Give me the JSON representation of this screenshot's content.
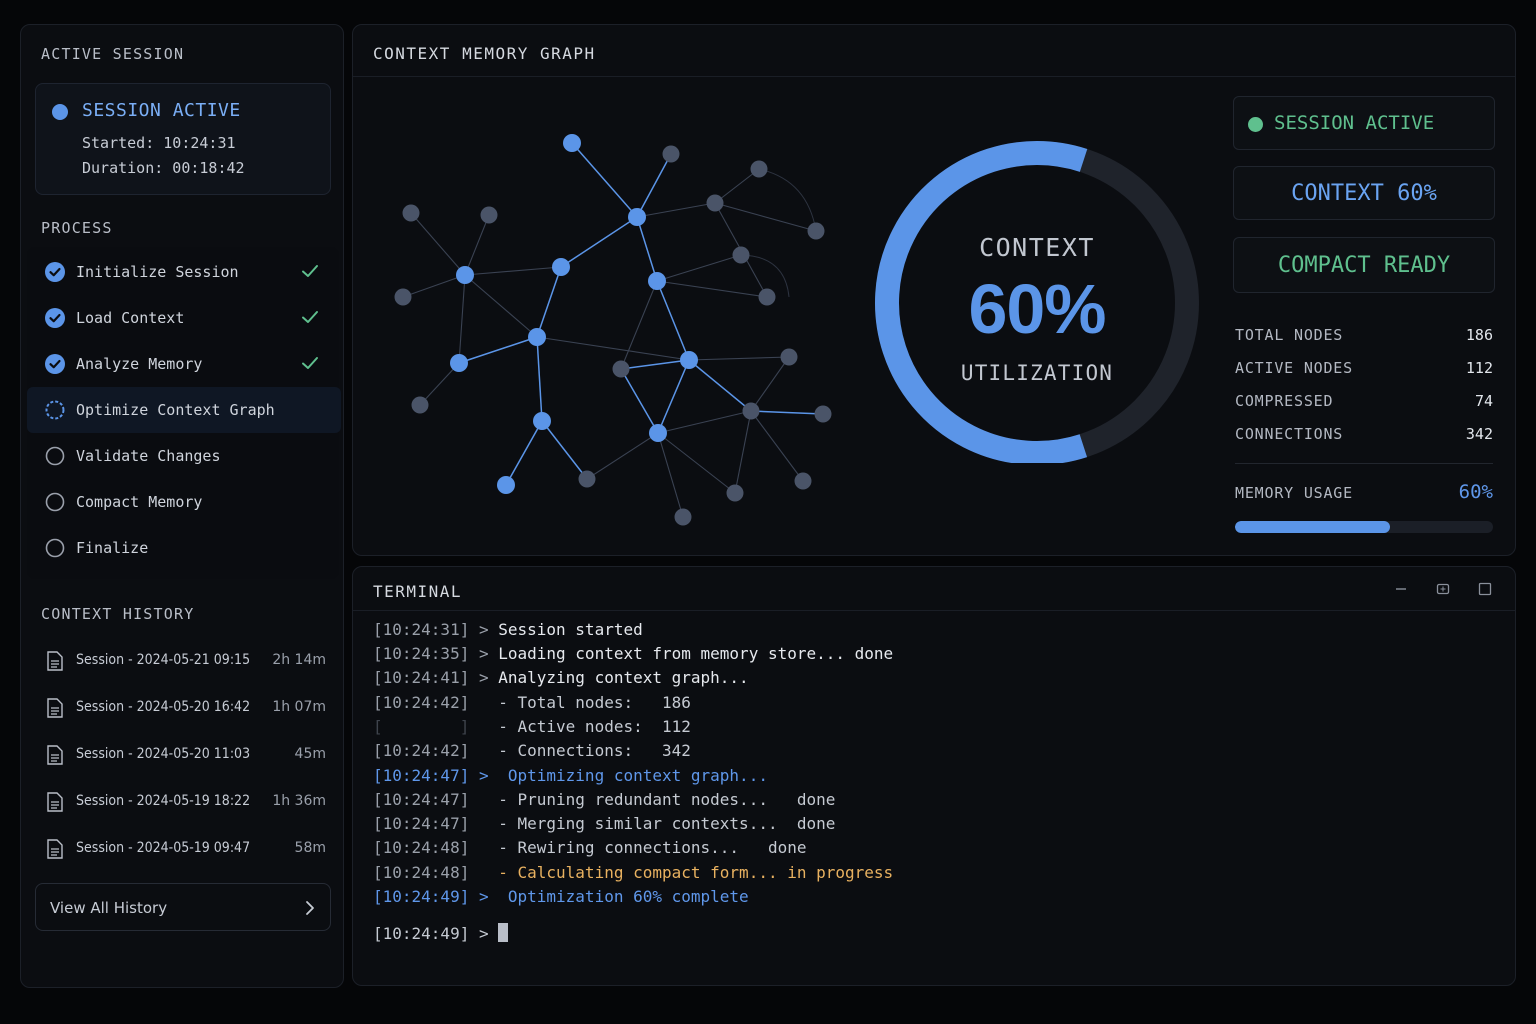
{
  "sidebar": {
    "active_session_title": "ACTIVE SESSION",
    "session": {
      "status": "SESSION ACTIVE",
      "started": "Started: 10:24:31",
      "duration": "Duration: 00:18:42"
    },
    "process_title": "PROCESS",
    "steps": [
      {
        "label": "Initialize Session",
        "state": "done"
      },
      {
        "label": "Load Context",
        "state": "done"
      },
      {
        "label": "Analyze Memory",
        "state": "done"
      },
      {
        "label": "Optimize Context Graph",
        "state": "in-progress"
      },
      {
        "label": "Validate Changes",
        "state": "pending"
      },
      {
        "label": "Compact Memory",
        "state": "pending"
      },
      {
        "label": "Finalize",
        "state": "pending"
      }
    ],
    "history_title": "CONTEXT HISTORY",
    "history": [
      {
        "label": "Session - 2024-05-21 09:15",
        "duration": "2h 14m"
      },
      {
        "label": "Session - 2024-05-20 16:42",
        "duration": "1h 07m"
      },
      {
        "label": "Session - 2024-05-20 11:03",
        "duration": "45m"
      },
      {
        "label": "Session - 2024-05-19 18:22",
        "duration": "1h 36m"
      },
      {
        "label": "Session - 2024-05-19 09:47",
        "duration": "58m"
      }
    ],
    "view_all_label": "View All History"
  },
  "graph": {
    "title": "CONTEXT MEMORY GRAPH",
    "gauge": {
      "label_top": "CONTEXT",
      "value_text": "60%",
      "label_bottom": "UTILIZATION",
      "fraction": 0.6
    },
    "status_boxes": {
      "session": "SESSION ACTIVE",
      "context": "CONTEXT 60%",
      "compact": "COMPACT READY"
    },
    "stats": [
      {
        "key": "TOTAL NODES",
        "value": "186"
      },
      {
        "key": "ACTIVE NODES",
        "value": "112"
      },
      {
        "key": "COMPRESSED",
        "value": "74"
      },
      {
        "key": "CONNECTIONS",
        "value": "342"
      }
    ],
    "memory_usage": {
      "label": "MEMORY USAGE",
      "value_text": "60%",
      "fraction": 0.6
    }
  },
  "terminal": {
    "title": "TERMINAL",
    "lines": [
      {
        "ts": "[10:24:31]",
        "prompt": " > ",
        "msg": "Session started",
        "style": ""
      },
      {
        "ts": "[10:24:35]",
        "prompt": " > ",
        "msg": "Loading context from memory store... done",
        "style": ""
      },
      {
        "ts": "[10:24:41]",
        "prompt": " > ",
        "msg": "Analyzing context graph...",
        "style": ""
      },
      {
        "ts": "[10:24:42]",
        "prompt": "   ",
        "msg": "- Total nodes:   186",
        "style": "dim"
      },
      {
        "ts": "[        ]",
        "prompt": "   ",
        "msg": "- Active nodes:  112",
        "style": "dim"
      },
      {
        "ts": "[10:24:42]",
        "prompt": "   ",
        "msg": "- Connections:   342",
        "style": "dim"
      },
      {
        "ts": "[10:24:47]",
        "prompt": " > ",
        "msg": " Optimizing context graph...",
        "style": "blue"
      },
      {
        "ts": "[10:24:47]",
        "prompt": "   ",
        "msg": "- Pruning redundant nodes...   done",
        "style": "dim"
      },
      {
        "ts": "[10:24:47]",
        "prompt": "   ",
        "msg": "- Merging similar contexts...  done",
        "style": "dim"
      },
      {
        "ts": "[10:24:48]",
        "prompt": "   ",
        "msg": "- Rewiring connections...   done",
        "style": "dim"
      },
      {
        "ts": "[10:24:48]",
        "prompt": "   ",
        "msg": "- Calculating compact form... in progress",
        "style": "orange"
      },
      {
        "ts": "[10:24:49]",
        "prompt": " > ",
        "msg": " Optimization 60% complete",
        "style": "blue"
      }
    ],
    "prompt_line": {
      "ts": "[10:24:49]",
      "prompt": " > "
    }
  },
  "colors": {
    "accent": "#5b95e8",
    "success": "#5fc08e",
    "warning": "#e8b160",
    "node_active": "#5b95e8",
    "node_inactive": "#4a5468"
  },
  "icons": {
    "step_done": "check-circle-icon",
    "step_in_progress": "spinner-ring-icon",
    "step_pending": "empty-circle-icon",
    "history_item": "document-icon",
    "view_all": "chevron-right-icon",
    "terminal_controls": [
      "minimize-icon",
      "restore-icon",
      "maximize-icon"
    ]
  }
}
